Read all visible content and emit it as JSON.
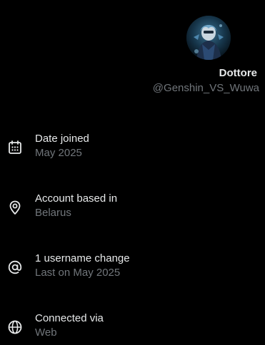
{
  "profile": {
    "display_name": "Dottore",
    "handle": "@Genshin_VS_Wuwa"
  },
  "about": [
    {
      "icon": "calendar-icon",
      "title": "Date joined",
      "subtitle": "May 2025"
    },
    {
      "icon": "location-pin-icon",
      "title": "Account based in",
      "subtitle": "Belarus"
    },
    {
      "icon": "at-sign-icon",
      "title": "1 username change",
      "subtitle": "Last on May 2025"
    },
    {
      "icon": "globe-icon",
      "title": "Connected via",
      "subtitle": "Web"
    }
  ],
  "colors": {
    "background": "#000000",
    "primary_text": "#e7e9ea",
    "secondary_text": "#71767b"
  }
}
